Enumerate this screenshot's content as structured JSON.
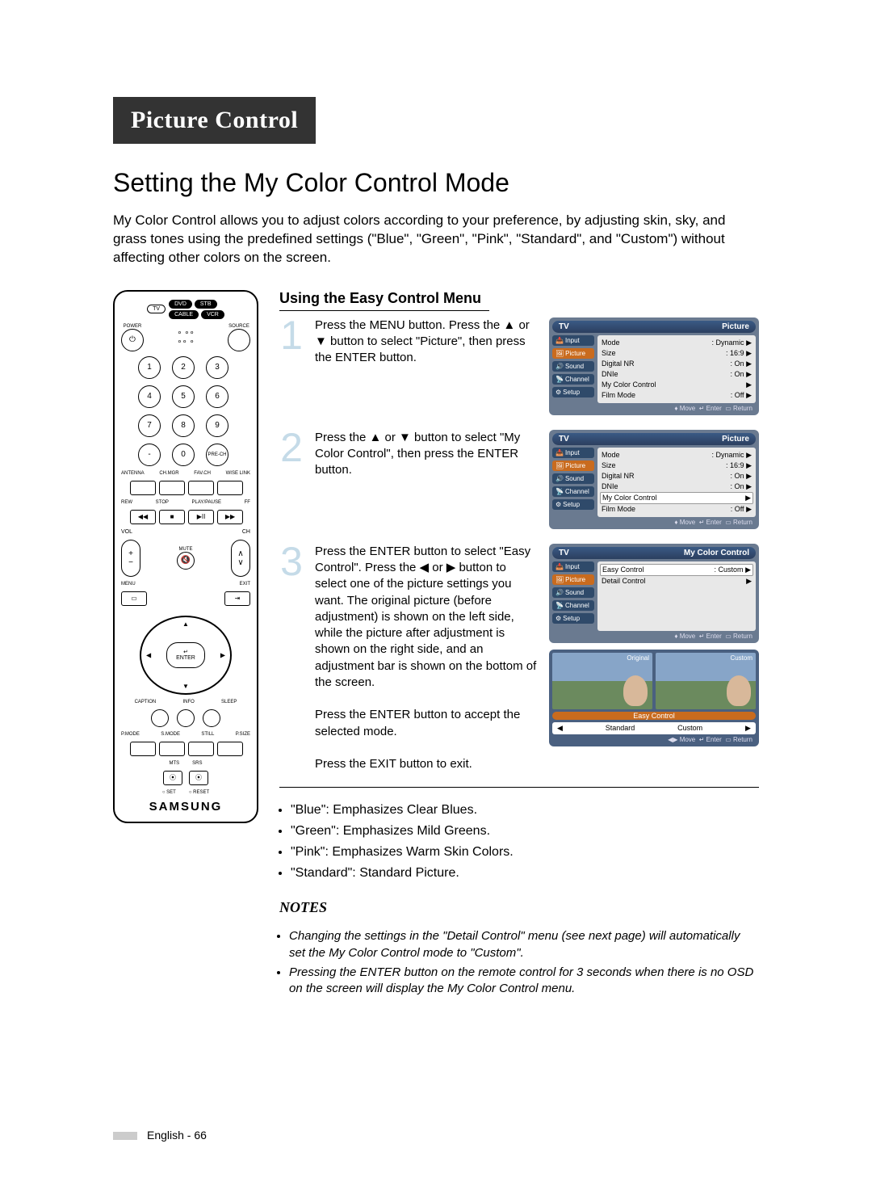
{
  "header": "Picture Control",
  "title": "Setting the My Color Control Mode",
  "intro": "My Color Control allows you to adjust colors according to your preference, by adjusting skin, sky, and grass tones using the predefined settings (\"Blue\", \"Green\", \"Pink\", \"Standard\", and \"Custom\") without affecting other colors on the screen.",
  "subheading": "Using the Easy Control Menu",
  "steps": [
    {
      "num": "1",
      "text": "Press the MENU button. Press the ▲ or ▼ button to select \"Picture\", then press the ENTER button."
    },
    {
      "num": "2",
      "text": "Press the ▲ or ▼ button to select \"My Color Control\", then press the ENTER button."
    },
    {
      "num": "3",
      "text": "Press the ENTER button to select \"Easy Control\". Press the ◀ or ▶ button to select one of the picture settings you want. The original picture (before adjustment) is shown on the left side, while the picture after adjustment is shown on the right side, and an adjustment bar is shown on the bottom of the screen.\n\nPress the ENTER button to accept the selected mode.\n\nPress the EXIT button to exit."
    }
  ],
  "osd_nav": [
    "Input",
    "Picture",
    "Sound",
    "Channel",
    "Setup"
  ],
  "osd1": {
    "tv": "TV",
    "title": "Picture",
    "selected": 1,
    "items": [
      {
        "l": "Mode",
        "v": ": Dynamic",
        "a": true
      },
      {
        "l": "Size",
        "v": ": 16:9",
        "a": true
      },
      {
        "l": "Digital NR",
        "v": ": On",
        "a": true
      },
      {
        "l": "DNIe",
        "v": ": On",
        "a": true
      },
      {
        "l": "My Color Control",
        "v": "",
        "a": true
      },
      {
        "l": "Film Mode",
        "v": ": Off",
        "a": true
      }
    ],
    "foot": {
      "move": "Move",
      "enter": "Enter",
      "ret": "Return"
    }
  },
  "osd2": {
    "tv": "TV",
    "title": "Picture",
    "selected": 1,
    "highlight": 4,
    "items": [
      {
        "l": "Mode",
        "v": ": Dynamic",
        "a": true
      },
      {
        "l": "Size",
        "v": ": 16:9",
        "a": true
      },
      {
        "l": "Digital NR",
        "v": ": On",
        "a": true
      },
      {
        "l": "DNIe",
        "v": ": On",
        "a": true
      },
      {
        "l": "My Color Control",
        "v": "",
        "a": true
      },
      {
        "l": "Film Mode",
        "v": ": Off",
        "a": true
      }
    ],
    "foot": {
      "move": "Move",
      "enter": "Enter",
      "ret": "Return"
    }
  },
  "osd3": {
    "tv": "TV",
    "title": "My Color Control",
    "selected": 1,
    "highlight": 0,
    "items": [
      {
        "l": "Easy Control",
        "v": ": Custom",
        "a": true
      },
      {
        "l": "Detail Control",
        "v": "",
        "a": true
      }
    ],
    "foot": {
      "move": "Move",
      "enter": "Enter",
      "ret": "Return"
    }
  },
  "preview": {
    "left": "Original",
    "right": "Custom",
    "bar": "Easy Control",
    "selL": "Standard",
    "selR": "Custom",
    "foot": {
      "move": "Move",
      "enter": "Enter",
      "ret": "Return"
    }
  },
  "bullets": [
    "\"Blue\": Emphasizes Clear Blues.",
    "\"Green\": Emphasizes Mild Greens.",
    "\"Pink\": Emphasizes Warm Skin Colors.",
    "\"Standard\": Standard Picture."
  ],
  "notes_h": "NOTES",
  "notes": [
    "Changing the settings in the \"Detail Control\" menu (see next page) will automatically set the My Color Control mode to \"Custom\".",
    "Pressing the ENTER button on the remote control for 3 seconds when there is no OSD on the screen will display the My Color Control menu."
  ],
  "remote": {
    "top": {
      "tv": "TV",
      "dvd": "DVD",
      "stb": "STB",
      "cable": "CABLE",
      "vcr": "VCR"
    },
    "power": "POWER",
    "source": "SOURCE",
    "keys": [
      "1",
      "2",
      "3",
      "4",
      "5",
      "6",
      "7",
      "8",
      "9",
      "-",
      "0"
    ],
    "prech": "PRE-CH",
    "row_lbls": [
      "ANTENNA",
      "CH.MGR",
      "FAV.CH",
      "WISE LINK"
    ],
    "media_lbls": [
      "REW",
      "STOP",
      "PLAY/PAUSE",
      "FF"
    ],
    "vol": "VOL",
    "ch": "CH",
    "mute": "MUTE",
    "menu": "MENU",
    "exit": "EXIT",
    "enter": "ENTER",
    "bottom_lbls": [
      "CAPTION",
      "INFO",
      "SLEEP"
    ],
    "mode_lbls": [
      "P.MODE",
      "S.MODE",
      "STILL",
      "P.SIZE"
    ],
    "mts": "MTS",
    "srs": "SRS",
    "set": "SET",
    "reset": "RESET",
    "brand": "SAMSUNG"
  },
  "footer": "English - 66"
}
